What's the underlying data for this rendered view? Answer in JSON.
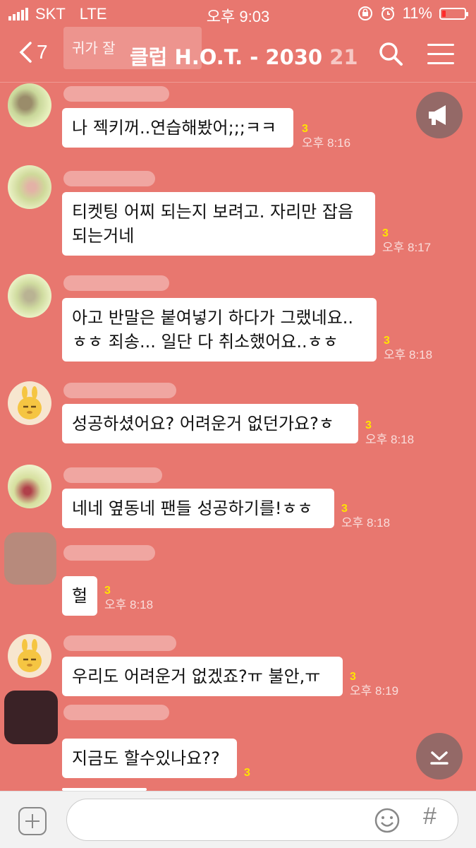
{
  "status_bar": {
    "carrier": "SKT",
    "network": "LTE",
    "time": "오후 9:03",
    "battery_percent": "11%"
  },
  "header": {
    "back_count": "7",
    "notice_preview": "귀가 잘",
    "title": "클럽 H.O.T.  - 2030",
    "member_count": "21"
  },
  "messages": [
    {
      "text": "나 젝키꺼..연습해봤어;;;ㅋㅋ",
      "unread": "3",
      "time": "오후 8:16"
    },
    {
      "text_lines": [
        "티켓팅 어찌 되는지 보려고. 자리만 잡음",
        "되는거네"
      ],
      "unread": "3",
      "time": "오후 8:17"
    },
    {
      "text_lines": [
        "아고 반말은 붙여넣기 하다가 그랬네요..",
        "ㅎㅎ 죄송... 일단 다 취소했어요..ㅎㅎ"
      ],
      "unread": "3",
      "time": "오후 8:18"
    },
    {
      "text": "성공하셨어요? 어려운거 없던가요?ㅎ",
      "unread": "3",
      "time": "오후 8:18"
    },
    {
      "text": "네네 옆동네 팬들 성공하기를!ㅎㅎ",
      "unread": "3",
      "time": "오후 8:18"
    },
    {
      "text": "헐",
      "unread": "3",
      "time": "오후 8:18"
    },
    {
      "text": "우리도 어려운거 없겠죠?ㅠ 불안,ㅠ",
      "unread": "3",
      "time": "오후 8:19"
    },
    {
      "text": "지금도 할수있나요??",
      "unread": "3",
      "time": ""
    }
  ],
  "icons": {
    "back": "chevron-left-icon",
    "search": "search-icon",
    "menu": "hamburger-icon",
    "notice": "megaphone-icon",
    "scroll_down": "arrow-down-icon",
    "add": "plus-icon",
    "emoji": "smiley-icon",
    "hashtag": "hashtag-icon"
  },
  "input": {
    "hash_glyph": "#"
  },
  "colors": {
    "chat_background": "#e8776f",
    "unread": "#ffe400",
    "bubble": "#ffffff"
  }
}
